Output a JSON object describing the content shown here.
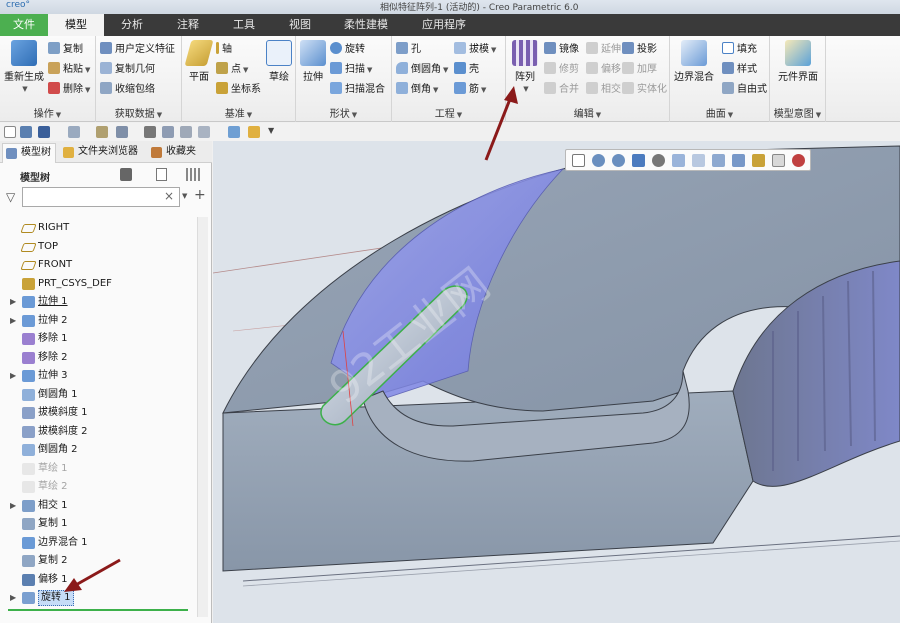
{
  "window": {
    "logo": "creo°",
    "title": "相似特征阵列-1 (活动的) - Creo Parametric 6.0"
  },
  "menu": {
    "tabs": [
      "文件",
      "模型",
      "分析",
      "注释",
      "工具",
      "视图",
      "柔性建模",
      "应用程序"
    ],
    "active_index": 1
  },
  "ribbon": {
    "operations": {
      "label": "操作",
      "regenerate": "重新生成",
      "copy": "复制",
      "paste": "粘贴",
      "delete": "删除"
    },
    "get_data": {
      "label": "获取数据",
      "udf": "用户定义特征",
      "copy_geometry": "复制几何",
      "shrinkwrap": "收缩包络"
    },
    "datum": {
      "label": "基准",
      "plane": "平面",
      "axis": "轴",
      "point": "点",
      "csys": "坐标系",
      "sketch": "草绘"
    },
    "shapes": {
      "label": "形状",
      "extrude": "拉伸",
      "revolve": "旋转",
      "sweep": "扫描",
      "swept_blend": "扫描混合"
    },
    "engineering": {
      "label": "工程",
      "hole": "孔",
      "round": "倒圆角",
      "chamfer": "倒角",
      "draft": "拔模",
      "shell": "壳",
      "rib": "筋"
    },
    "editing": {
      "label": "编辑",
      "pattern": "阵列",
      "mirror": "镜像",
      "trim": "修剪",
      "merge": "合并",
      "extend": "延伸",
      "offset": "偏移",
      "intersect": "相交",
      "project": "投影",
      "thicken": "加厚",
      "solidify": "实体化"
    },
    "surfaces": {
      "label": "曲面",
      "boundary_blend": "边界混合",
      "fill": "填充",
      "style": "样式",
      "freestyle": "自由式"
    },
    "model_intent": {
      "label": "模型意图",
      "component_interface": "元件界面"
    }
  },
  "panel": {
    "tabs": [
      "模型树",
      "文件夹浏览器",
      "收藏夹"
    ],
    "tree_title": "模型树",
    "filter_value": "",
    "filter_clear": "×",
    "filter_add": "+"
  },
  "tree": [
    {
      "label": "RIGHT",
      "icon": "datum-plane-icon",
      "expandable": false,
      "state": "normal"
    },
    {
      "label": "TOP",
      "icon": "datum-plane-icon",
      "expandable": false,
      "state": "normal"
    },
    {
      "label": "FRONT",
      "icon": "datum-plane-icon",
      "expandable": false,
      "state": "normal"
    },
    {
      "label": "PRT_CSYS_DEF",
      "icon": "csys-icon",
      "expandable": false,
      "state": "normal"
    },
    {
      "label": "拉伸 1",
      "icon": "extrude-icon",
      "expandable": true,
      "state": "underlined"
    },
    {
      "label": "拉伸 2",
      "icon": "extrude-icon",
      "expandable": true,
      "state": "normal"
    },
    {
      "label": "移除 1",
      "icon": "remove-icon",
      "expandable": false,
      "state": "normal"
    },
    {
      "label": "移除 2",
      "icon": "remove-icon",
      "expandable": false,
      "state": "normal"
    },
    {
      "label": "拉伸 3",
      "icon": "extrude-icon",
      "expandable": true,
      "state": "normal"
    },
    {
      "label": "倒圆角 1",
      "icon": "round-icon",
      "expandable": false,
      "state": "normal"
    },
    {
      "label": "拔模斜度 1",
      "icon": "draft-icon",
      "expandable": false,
      "state": "normal"
    },
    {
      "label": "拔模斜度 2",
      "icon": "draft-icon",
      "expandable": false,
      "state": "normal"
    },
    {
      "label": "倒圆角 2",
      "icon": "round-icon",
      "expandable": false,
      "state": "normal"
    },
    {
      "label": "草绘 1",
      "icon": "sketch-icon",
      "expandable": false,
      "state": "suppressed"
    },
    {
      "label": "草绘 2",
      "icon": "sketch-icon",
      "expandable": false,
      "state": "suppressed"
    },
    {
      "label": "相交 1",
      "icon": "intersect-icon",
      "expandable": true,
      "state": "normal"
    },
    {
      "label": "复制 1",
      "icon": "copy-icon",
      "expandable": false,
      "state": "normal"
    },
    {
      "label": "边界混合 1",
      "icon": "boundary-blend-icon",
      "expandable": false,
      "state": "normal"
    },
    {
      "label": "复制 2",
      "icon": "copy-icon",
      "expandable": false,
      "state": "normal"
    },
    {
      "label": "偏移 1",
      "icon": "offset-icon",
      "expandable": false,
      "state": "normal"
    },
    {
      "label": "旋转 1",
      "icon": "revolve-icon",
      "expandable": true,
      "state": "selected"
    }
  ],
  "viewport": {
    "watermark": "92工业网"
  },
  "colors": {
    "file_tab": "#4caf50",
    "menubar": "#3a3a3a",
    "selection": "#c6dcf7",
    "arrow": "#8b1a1a",
    "model_body": "#8f9cad",
    "model_face_highlight": "#7f86e6"
  }
}
